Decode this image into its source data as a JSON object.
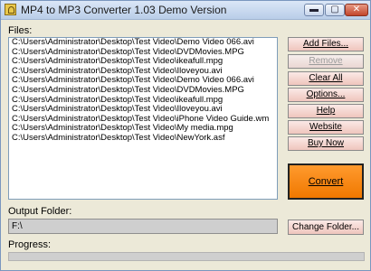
{
  "window": {
    "title": "MP4 to MP3 Converter 1.03 Demo Version",
    "minimize_glyph": "▬",
    "maximize_glyph": "▢",
    "close_glyph": "✕"
  },
  "files": {
    "label": "Files:",
    "items": [
      "C:\\Users\\Administrator\\Desktop\\Test Video\\Demo Video 066.avi",
      "C:\\Users\\Administrator\\Desktop\\Test Video\\DVDMovies.MPG",
      "C:\\Users\\Administrator\\Desktop\\Test Video\\ikeafull.mpg",
      "C:\\Users\\Administrator\\Desktop\\Test Video\\Iloveyou.avi",
      "C:\\Users\\Administrator\\Desktop\\Test Video\\Demo Video 066.avi",
      "C:\\Users\\Administrator\\Desktop\\Test Video\\DVDMovies.MPG",
      "C:\\Users\\Administrator\\Desktop\\Test Video\\ikeafull.mpg",
      "C:\\Users\\Administrator\\Desktop\\Test Video\\Iloveyou.avi",
      "C:\\Users\\Administrator\\Desktop\\Test Video\\iPhone Video Guide.wm",
      "C:\\Users\\Administrator\\Desktop\\Test Video\\My media.mpg",
      "C:\\Users\\Administrator\\Desktop\\Test Video\\NewYork.asf"
    ]
  },
  "buttons": {
    "add_files": "Add Files...",
    "remove": "Remove",
    "clear_all": "Clear All",
    "options": "Options...",
    "help": "Help",
    "website": "Website",
    "buy_now": "Buy Now",
    "convert": "Convert",
    "change_folder": "Change Folder..."
  },
  "output": {
    "label": "Output Folder:",
    "value": "F:\\"
  },
  "progress": {
    "label": "Progress:",
    "value": 0
  },
  "colors": {
    "convert_accent": "#f07800",
    "side_button": "#efc5bd"
  }
}
